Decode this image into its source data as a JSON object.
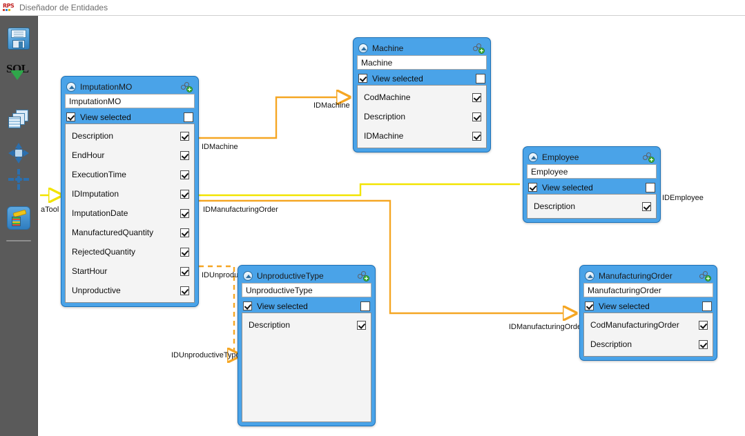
{
  "window": {
    "title": "Diseñador de Entidades",
    "app_icon": "rps-icon"
  },
  "toolbar": {
    "items": [
      {
        "name": "save-button",
        "icon": "floppy-disk-icon",
        "label": "Guardar"
      },
      {
        "name": "sql-button",
        "icon": "sql-check-icon",
        "label": "SQL"
      },
      {
        "name": "tables-button",
        "icon": "stacked-tables-icon",
        "label": "Tablas"
      },
      {
        "name": "arrange-button",
        "icon": "move-arrows-icon",
        "label": "Mover"
      },
      {
        "name": "collapse-button",
        "icon": "collapse-arrows-icon",
        "label": "Contraer"
      },
      {
        "name": "edit-button",
        "icon": "pencil-edit-icon",
        "label": "Editar"
      }
    ]
  },
  "labels": {
    "view_selected": "View selected"
  },
  "entities": [
    {
      "id": "imputationmo",
      "title": "ImputationMO",
      "name_value": "ImputationMO",
      "view_selected": true,
      "view_selected_right": false,
      "fields": [
        {
          "name": "Description",
          "checked": true
        },
        {
          "name": "EndHour",
          "checked": true
        },
        {
          "name": "ExecutionTime",
          "checked": true
        },
        {
          "name": "IDImputation",
          "checked": true
        },
        {
          "name": "ImputationDate",
          "checked": true
        },
        {
          "name": "ManufacturedQuantity",
          "checked": true
        },
        {
          "name": "RejectedQuantity",
          "checked": true
        },
        {
          "name": "StartHour",
          "checked": true
        },
        {
          "name": "Unproductive",
          "checked": true
        }
      ]
    },
    {
      "id": "machine",
      "title": "Machine",
      "name_value": "Machine",
      "view_selected": true,
      "view_selected_right": false,
      "fields": [
        {
          "name": "CodMachine",
          "checked": true
        },
        {
          "name": "Description",
          "checked": true
        },
        {
          "name": "IDMachine",
          "checked": true
        }
      ]
    },
    {
      "id": "employee",
      "title": "Employee",
      "name_value": "Employee",
      "view_selected": true,
      "view_selected_right": false,
      "fields": [
        {
          "name": "Description",
          "checked": true
        }
      ]
    },
    {
      "id": "unproductivetype",
      "title": "UnproductiveType",
      "name_value": "UnproductiveType",
      "view_selected": true,
      "view_selected_right": false,
      "fields": [
        {
          "name": "Description",
          "checked": true
        }
      ]
    },
    {
      "id": "manufacturingorder",
      "title": "ManufacturingOrder",
      "name_value": "ManufacturingOrder",
      "view_selected": true,
      "view_selected_right": false,
      "fields": [
        {
          "name": "CodManufacturingOrder",
          "checked": true
        },
        {
          "name": "Description",
          "checked": true
        }
      ]
    }
  ],
  "connections": [
    {
      "label": "aTool",
      "color": "#f2e400",
      "style": "solid",
      "truncated": true
    },
    {
      "label": "IDMachine",
      "color": "#f5a623",
      "style": "solid"
    },
    {
      "label": "IDMachine",
      "color": "#f5a623",
      "style": "solid"
    },
    {
      "label": "IDManufacturingOrder",
      "color": "#f2e400",
      "style": "solid"
    },
    {
      "label": "IDEmployee",
      "color": "#f2e400",
      "style": "solid"
    },
    {
      "label": "IDUnproductiveType",
      "color": "#f5a623",
      "style": "dashed"
    },
    {
      "label": "IDUnproductiveType",
      "color": "#f5a623",
      "style": "dashed"
    },
    {
      "label": "IDManufacturingOrder",
      "color": "#f5a623",
      "style": "solid"
    }
  ],
  "colors": {
    "entity_header": "#4aa3e8",
    "entity_border": "#1b6fb5",
    "wire_orange": "#f5a623",
    "wire_yellow": "#f2e400",
    "rail_bg": "#5a5a5a",
    "canvas_bg": "#ffffff"
  }
}
